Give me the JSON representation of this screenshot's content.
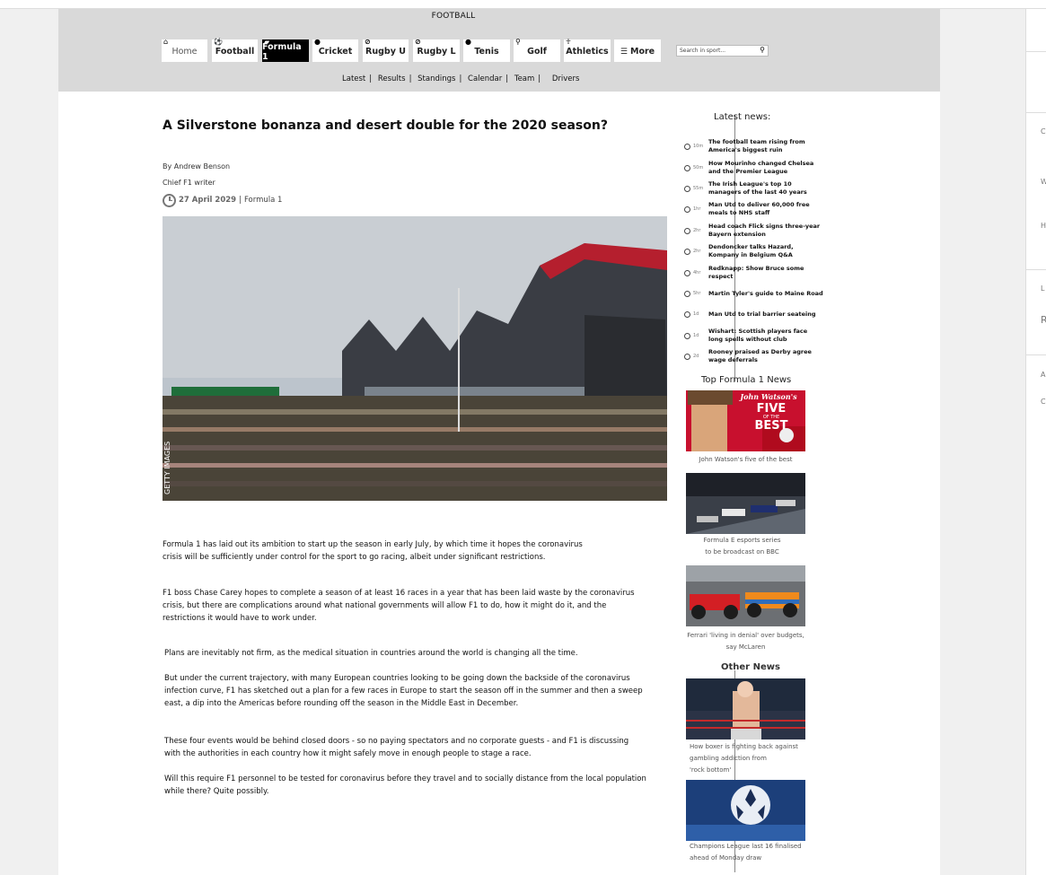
{
  "section_title": "FOOTBALL",
  "nav": [
    {
      "label": "Home",
      "icon": "home-icon"
    },
    {
      "label": "Football",
      "icon": "football-icon"
    },
    {
      "label": "Formula 1",
      "icon": "formula1-icon",
      "active": true
    },
    {
      "label": "Cricket",
      "icon": "cricket-icon"
    },
    {
      "label": "Rugby U",
      "icon": "rugby-ball-icon"
    },
    {
      "label": "Rugby L",
      "icon": "rugby-ball-icon"
    },
    {
      "label": "Tenis",
      "icon": "tennis-ball-icon"
    },
    {
      "label": "Golf",
      "icon": "golf-pin-icon"
    },
    {
      "label": "Athletics",
      "icon": "runner-icon"
    },
    {
      "label": "More",
      "icon": "menu-icon"
    }
  ],
  "search": {
    "placeholder": "Search in sport..."
  },
  "subnav": [
    "Latest",
    "Results",
    "Standings",
    "Calendar",
    "Team",
    "Drivers"
  ],
  "article": {
    "title": "A Silverstone bonanza and desert double for the 2020 season?",
    "author": "By Andrew Benson",
    "author_role": "Chief F1 writer",
    "date": "27 April 2029",
    "category": "Formula 1",
    "image_credit": "GETTY IMAGES",
    "paragraphs": [
      "Formula 1 has laid out its ambition to start up the season in early July, by which time it hopes the coronavirus\ncrisis will be sufficiently under control for the sport to go racing, albeit under significant restrictions.",
      "F1 boss Chase Carey hopes to complete a season of at least 16 races in a year that has been laid waste by the coronavirus\ncrisis, but there are complications around what national governments will allow F1 to do, how it might do it, and the\nrestrictions it would have to work under.",
      "Plans are inevitably not firm, as the medical situation in countries around the world is changing all the time.",
      "But under the current trajectory, with many European countries looking to be going down the backside of the coronavirus\ninfection curve, F1 has sketched out a plan for a few races in Europe to start the season off in the summer and then a sweep\neast, a dip into the Americas before rounding off the season in the Middle East in December.",
      "These four events would be behind closed doors - so no paying spectators and no corporate guests - and F1 is discussing\n with the authorities in each country how it might safely move in enough people to stage a race.",
      "Will this require F1 personnel to be tested for coronavirus before they travel and to socially distance from the local population\n while there? Quite possibly."
    ]
  },
  "latest_news": {
    "title": "Latest news:",
    "items": [
      {
        "time": "10m",
        "headline": "The football team rising from America's biggest ruin"
      },
      {
        "time": "50m",
        "headline": "How Mourinho changed Chelsea and the Premier League"
      },
      {
        "time": "55m",
        "headline": "The Irish League's top 10 managers of the last 40 years"
      },
      {
        "time": "1hr",
        "headline": "Man Utd to deliver 60,000 free meals to NHS staff"
      },
      {
        "time": "2hr",
        "headline": "Head coach Flick signs three-year Bayern extension"
      },
      {
        "time": "2hr",
        "headline": "Dendoncker talks Hazard, Kompany in Belgium Q&A"
      },
      {
        "time": "4hr",
        "headline": "Redknapp: Show Bruce some respect"
      },
      {
        "time": "5hr",
        "headline": "Martin Tyler's guide to Maine Road"
      },
      {
        "time": "1d",
        "headline": "Man Utd to trial barrier seateing"
      },
      {
        "time": "1d",
        "headline": "Wishart: Scottish players face long spells without club"
      },
      {
        "time": "2d",
        "headline": "Rooney praised as Derby agree wage deferrals"
      }
    ]
  },
  "top_f1": {
    "title": "Top Formula 1 News",
    "items": [
      {
        "caption": "John Watson's five of the best",
        "overlay_name": "John Watson's",
        "overlay_big": "FIVE",
        "overlay_small": "OF THE",
        "overlay_best": "BEST"
      },
      {
        "caption": "Formula E esports series\nto be broadcast on BBC"
      },
      {
        "caption": "Ferrari 'living in denial' over budgets,\nsay McLaren"
      }
    ]
  },
  "other_news": {
    "title": "Other News",
    "items": [
      {
        "caption": "How boxer is fighting back against\ngambling addiction from\n'rock bottom'"
      },
      {
        "caption": "Champions League last 16 finalised\n ahead of Monday draw"
      }
    ]
  },
  "right_panel_letters": [
    "C",
    "W",
    "H",
    "L",
    "R",
    "A",
    "C"
  ],
  "colors": {
    "sport_bar": "#d9d9d9",
    "nav_active_bg": "#000000",
    "headline_banner_red": "#c8102e"
  }
}
